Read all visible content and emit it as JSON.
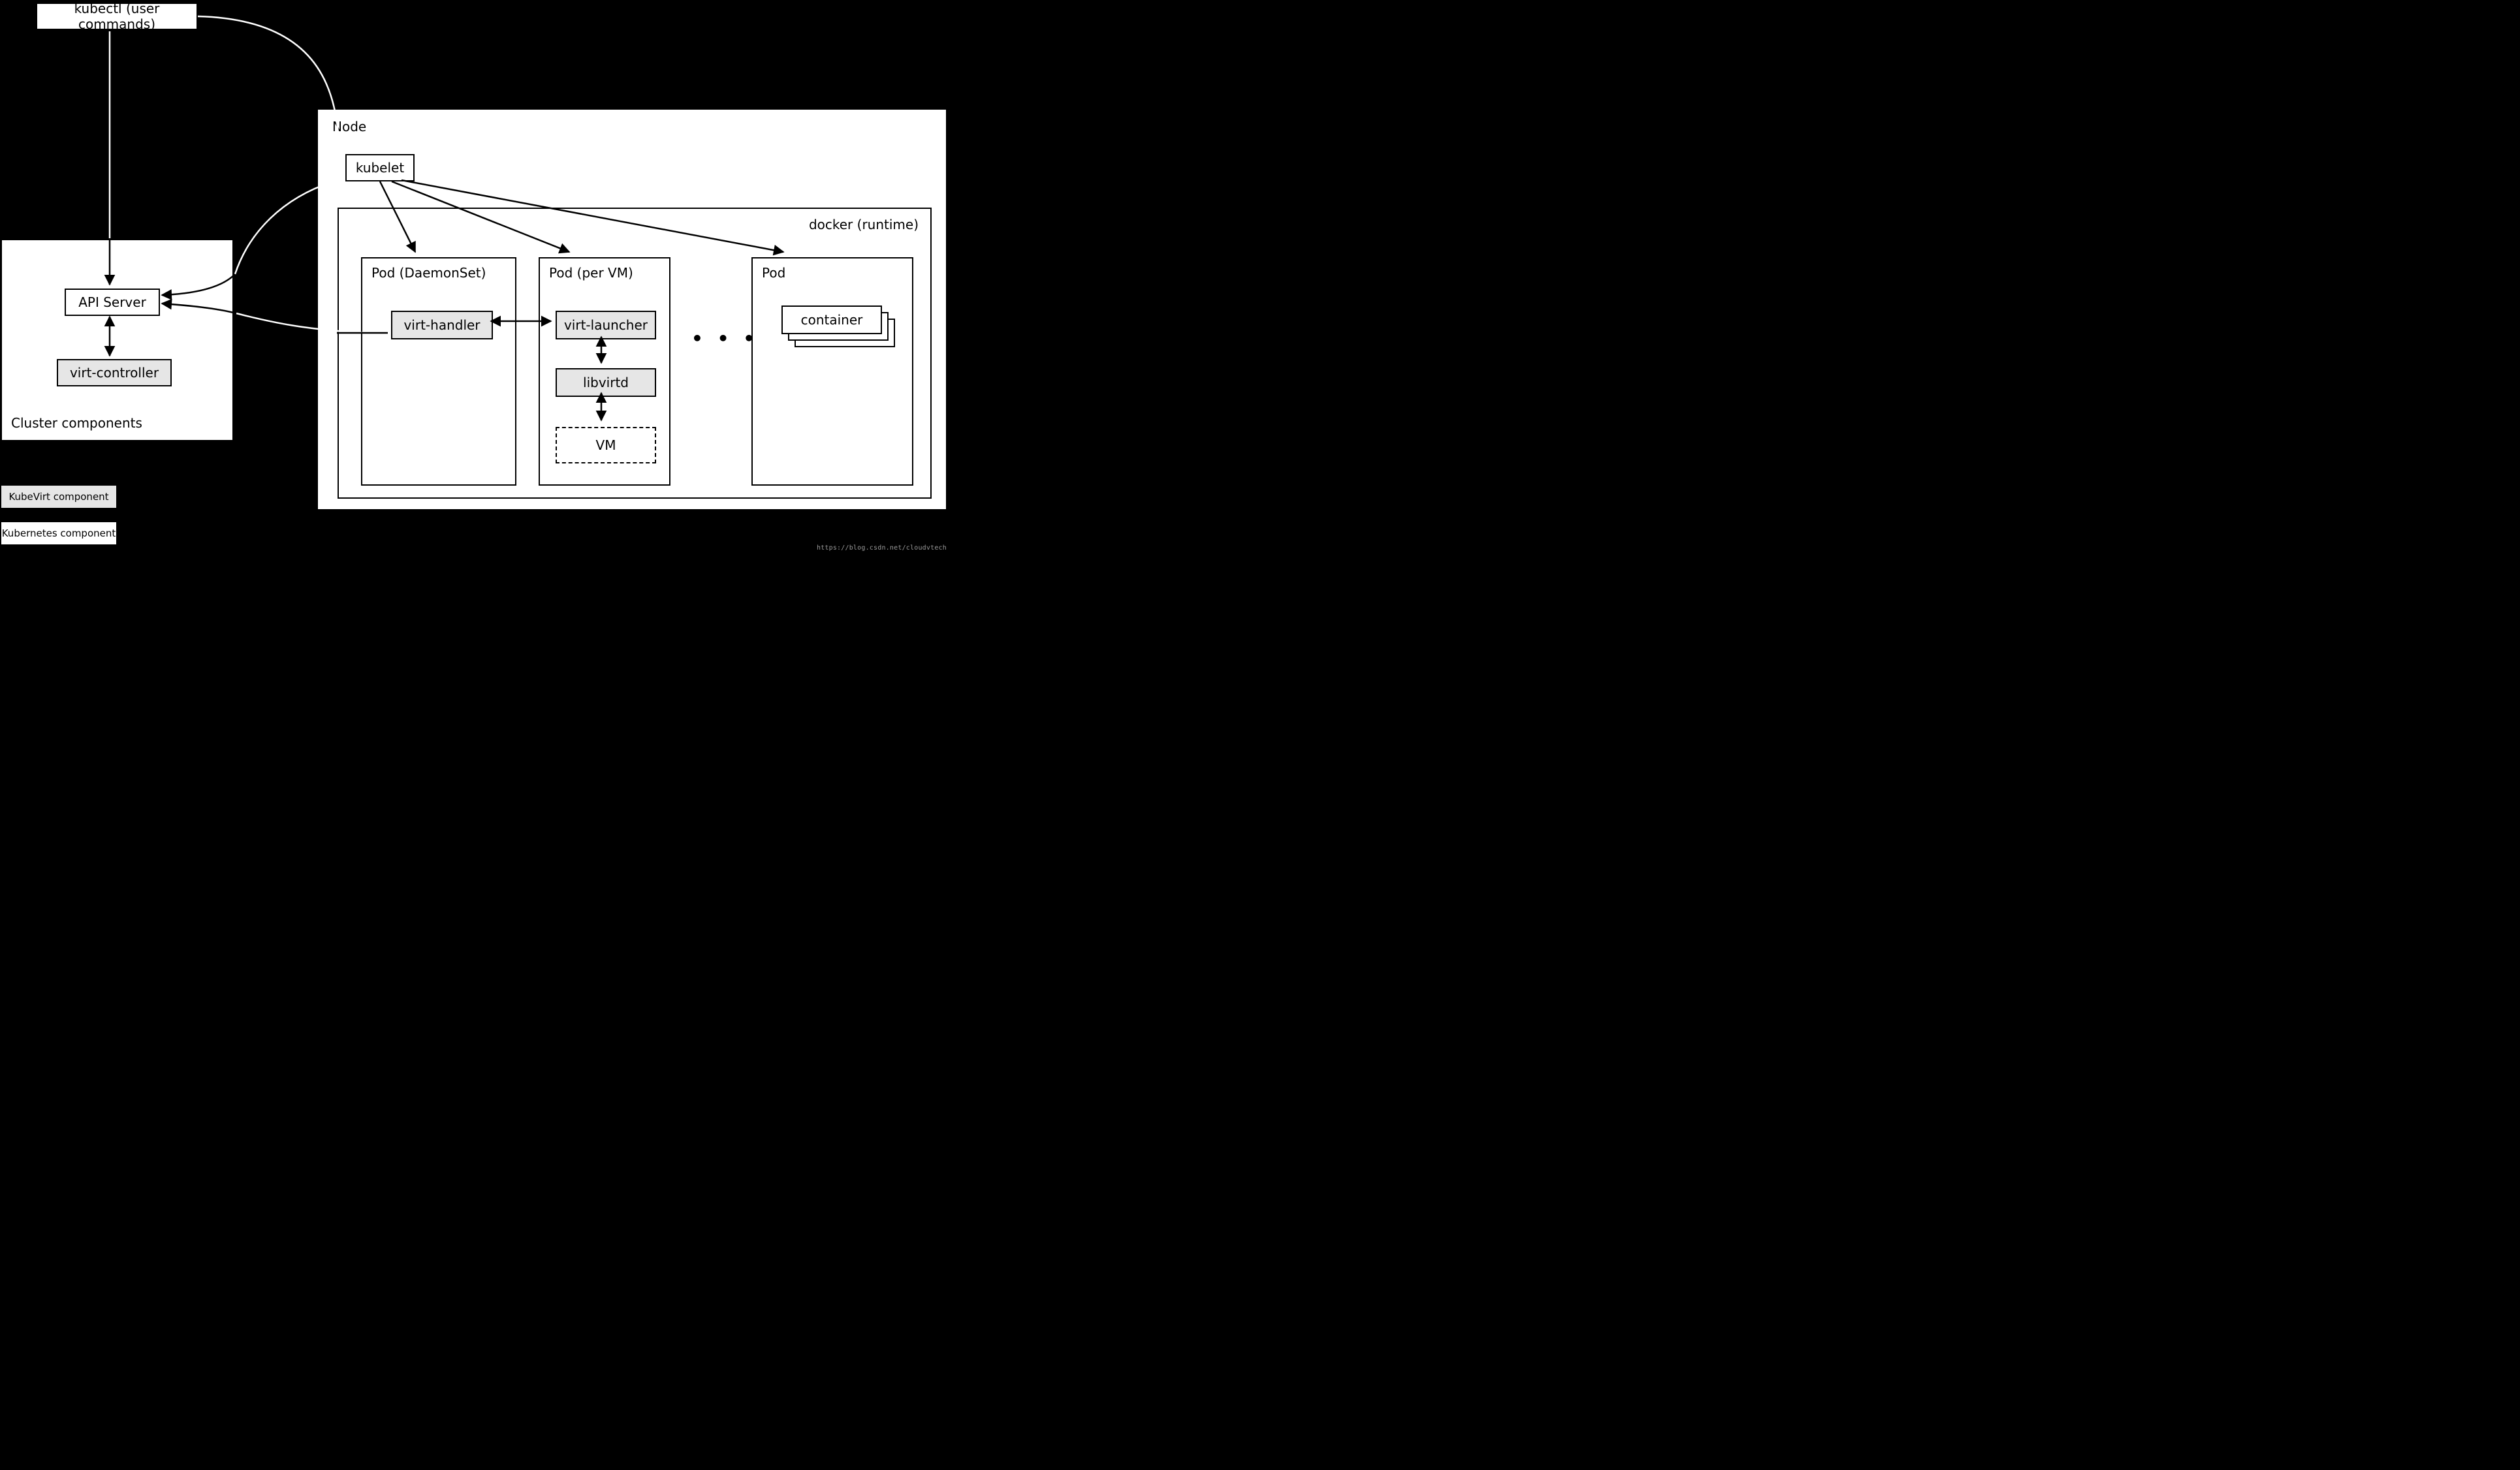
{
  "title_box": "kubectl (user commands)",
  "cluster": {
    "title": "Cluster components",
    "api_server": "API Server",
    "virt_controller": "virt-controller"
  },
  "node": {
    "title": "Node",
    "kubelet": "kubelet",
    "runtime_label": "docker (runtime)",
    "pod_daemonset": {
      "title": "Pod (DaemonSet)",
      "virt_handler": "virt-handler"
    },
    "pod_vm": {
      "title": "Pod (per VM)",
      "virt_launcher": "virt-launcher",
      "libvirtd": "libvirtd",
      "vm": "VM"
    },
    "pod_plain": {
      "title": "Pod",
      "container": "container"
    },
    "ellipsis": "•  •  •"
  },
  "legend": {
    "kubevirt": "KubeVirt component",
    "kubernetes": "Kubernetes component"
  },
  "watermark": "https://blog.csdn.net/cloudvtech"
}
